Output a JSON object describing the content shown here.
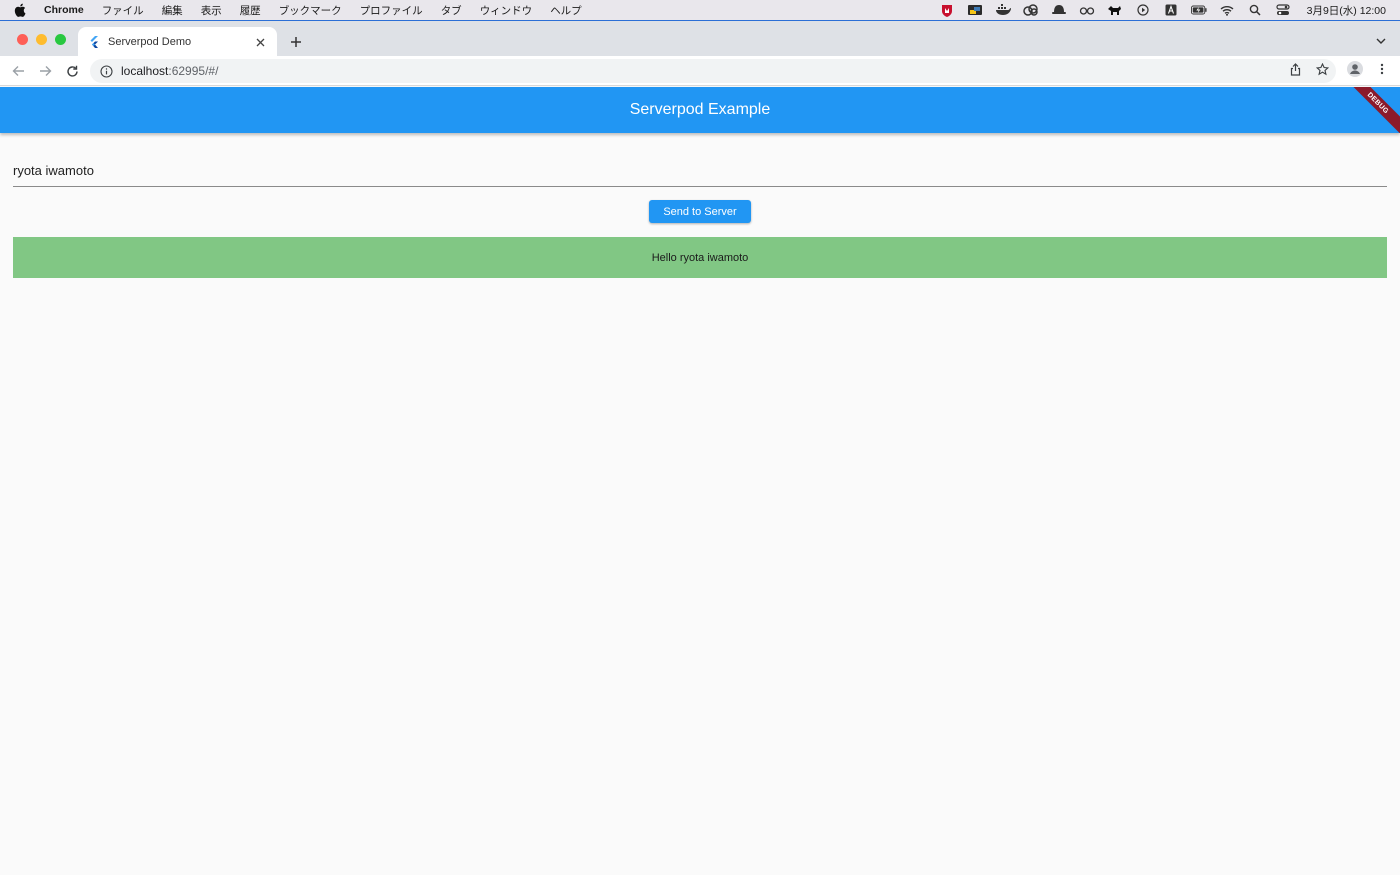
{
  "menubar": {
    "app": "Chrome",
    "items": [
      "ファイル",
      "編集",
      "表示",
      "履歴",
      "ブックマーク",
      "プロファイル",
      "タブ",
      "ウィンドウ",
      "ヘルプ"
    ],
    "clock": "3月9日(水)  12:00"
  },
  "browser": {
    "tab_title": "Serverpod Demo",
    "url_host": "localhost",
    "url_rest": ":62995/#/"
  },
  "app": {
    "title": "Serverpod Example",
    "debug_label": "DEBUG",
    "input_value": "ryota iwamoto",
    "send_button": "Send to Server",
    "result_text": "Hello ryota iwamoto",
    "colors": {
      "primary": "#2196f3",
      "result_bg": "#81c784",
      "debug_banner": "#8b1a2b"
    }
  }
}
